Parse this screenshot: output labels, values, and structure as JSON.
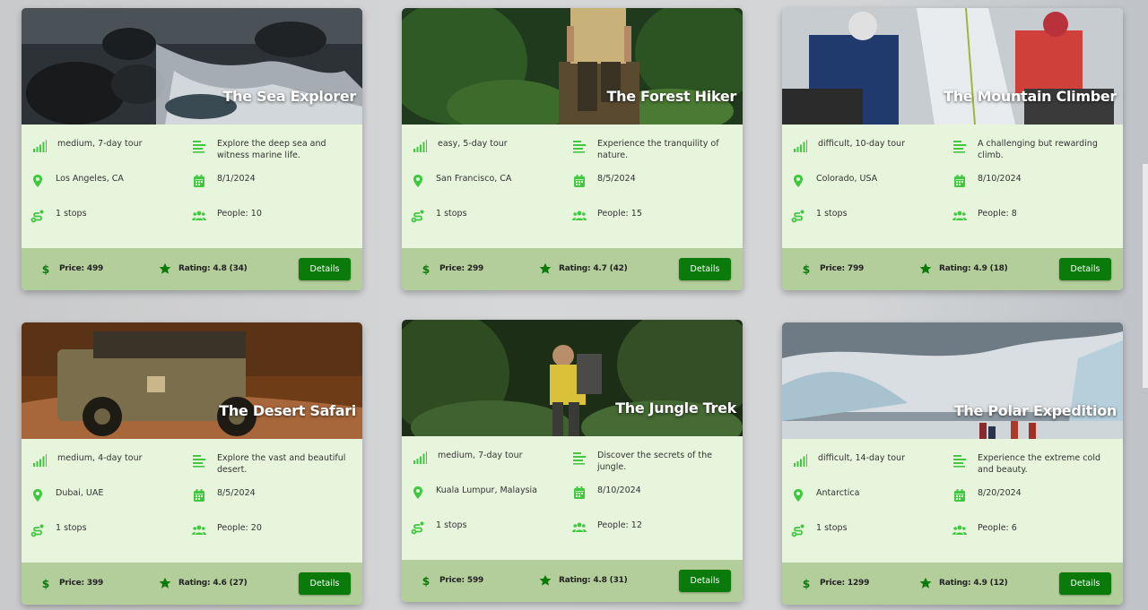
{
  "accent_color": "#0a7a0a",
  "icon_color": "#3ec93e",
  "icons": {
    "difficulty": "signal-bars-icon",
    "description": "text-lines-icon",
    "location": "map-pin-icon",
    "date": "calendar-icon",
    "stops": "route-icon",
    "people": "users-icon",
    "price": "dollar-icon",
    "rating": "star-icon"
  },
  "button_label": "Details",
  "tours": [
    {
      "title": "The Sea Explorer",
      "difficulty": "medium, 7-day tour",
      "description": "Explore the deep sea and witness marine life.",
      "location": "Los Angeles, CA",
      "date": "8/1/2024",
      "stops": "1 stops",
      "people": "People: 10",
      "price": "Price: 499",
      "rating": "Rating: 4.8 (34)"
    },
    {
      "title": "The Forest Hiker",
      "difficulty": "easy, 5-day tour",
      "description": "Experience the tranquility of nature.",
      "location": "San Francisco, CA",
      "date": "8/5/2024",
      "stops": "1 stops",
      "people": "People: 15",
      "price": "Price: 299",
      "rating": "Rating: 4.7 (42)"
    },
    {
      "title": "The Mountain Climber",
      "difficulty": "difficult, 10-day tour",
      "description": "A challenging but rewarding climb.",
      "location": "Colorado, USA",
      "date": "8/10/2024",
      "stops": "1 stops",
      "people": "People: 8",
      "price": "Price: 799",
      "rating": "Rating: 4.9 (18)"
    },
    {
      "title": "The Desert Safari",
      "difficulty": "medium, 4-day tour",
      "description": "Explore the vast and beautiful desert.",
      "location": "Dubai, UAE",
      "date": "8/5/2024",
      "stops": "1 stops",
      "people": "People: 20",
      "price": "Price: 399",
      "rating": "Rating: 4.6 (27)"
    },
    {
      "title": "The Jungle Trek",
      "difficulty": "medium, 7-day tour",
      "description": "Discover the secrets of the jungle.",
      "location": "Kuala Lumpur, Malaysia",
      "date": "8/10/2024",
      "stops": "1 stops",
      "people": "People: 12",
      "price": "Price: 599",
      "rating": "Rating: 4.8 (31)"
    },
    {
      "title": "The Polar Expedition",
      "difficulty": "difficult, 14-day tour",
      "description": "Experience the extreme cold and beauty.",
      "location": "Antarctica",
      "date": "8/20/2024",
      "stops": "1 stops",
      "people": "People: 6",
      "price": "Price: 1299",
      "rating": "Rating: 4.9 (12)"
    }
  ]
}
